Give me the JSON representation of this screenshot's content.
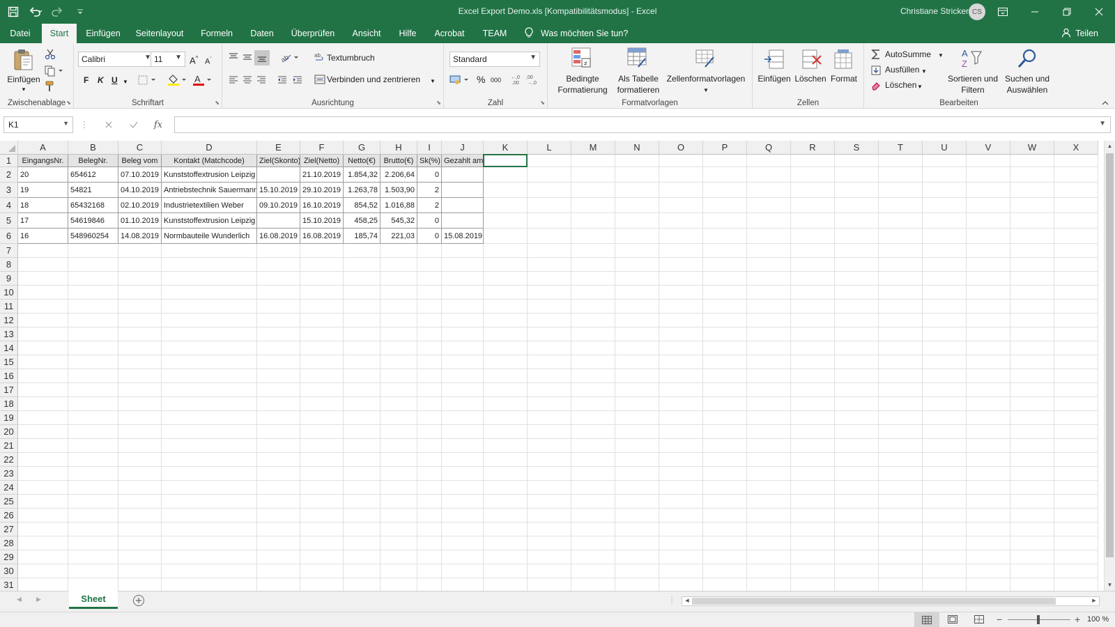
{
  "window": {
    "title": "Excel Export Demo.xls  [Kompatibilitätsmodus]  -  Excel",
    "user": "Christiane Stricker",
    "initials": "CS"
  },
  "menu": {
    "tabs": [
      "Datei",
      "Start",
      "Einfügen",
      "Seitenlayout",
      "Formeln",
      "Daten",
      "Überprüfen",
      "Ansicht",
      "Hilfe",
      "Acrobat",
      "TEAM"
    ],
    "active": "Start",
    "tell_me": "Was möchten Sie tun?",
    "share": "Teilen"
  },
  "ribbon": {
    "clipboard": {
      "label": "Zwischenablage",
      "paste": "Einfügen"
    },
    "font": {
      "label": "Schriftart",
      "name": "Calibri",
      "size": "11",
      "bold": "F",
      "italic": "K",
      "underline": "U"
    },
    "alignment": {
      "label": "Ausrichtung",
      "wrap": "Textumbruch",
      "merge": "Verbinden und zentrieren"
    },
    "number": {
      "label": "Zahl",
      "format": "Standard",
      "percent": "%",
      "thousands": "000"
    },
    "styles": {
      "label": "Formatvorlagen",
      "conditional_1": "Bedingte",
      "conditional_2": "Formatierung",
      "table_1": "Als Tabelle",
      "table_2": "formatieren",
      "cellstyles": "Zellenformatvorlagen"
    },
    "cells": {
      "label": "Zellen",
      "insert": "Einfügen",
      "delete": "Löschen",
      "format": "Format"
    },
    "editing": {
      "label": "Bearbeiten",
      "autosum": "AutoSumme",
      "fill": "Ausfüllen",
      "clear": "Löschen",
      "sort_1": "Sortieren und",
      "sort_2": "Filtern",
      "find_1": "Suchen und",
      "find_2": "Auswählen"
    }
  },
  "formula_bar": {
    "name_box": "K1",
    "fx": "fx",
    "content": ""
  },
  "columns": [
    "A",
    "B",
    "C",
    "D",
    "E",
    "F",
    "G",
    "H",
    "I",
    "J",
    "K",
    "L",
    "M",
    "N",
    "O",
    "P",
    "Q",
    "R",
    "S",
    "T",
    "U",
    "V",
    "W",
    "X"
  ],
  "rows": [
    "1",
    "2",
    "3",
    "4",
    "5",
    "6",
    "7",
    "8",
    "9",
    "10",
    "11",
    "12",
    "13",
    "14",
    "15",
    "16",
    "17",
    "18",
    "19",
    "20",
    "21",
    "22",
    "23",
    "24",
    "25",
    "26",
    "27",
    "28",
    "29",
    "30",
    "31"
  ],
  "table": {
    "headers": [
      "EingangsNr.",
      "BelegNr.",
      "Beleg vom",
      "Kontakt (Matchcode)",
      "Ziel(Skonto)",
      "Ziel(Netto)",
      "Netto(€)",
      "Brutto(€)",
      "Sk(%)",
      "Gezahlt am"
    ],
    "rows": [
      [
        "20",
        "654612",
        "07.10.2019",
        "Kunststoffextrusion Leipzig",
        "",
        "21.10.2019",
        "1.854,32",
        "2.206,64",
        "0",
        ""
      ],
      [
        "19",
        "54821",
        "04.10.2019",
        "Antriebstechnik Sauermann",
        "15.10.2019",
        "29.10.2019",
        "1.263,78",
        "1.503,90",
        "2",
        ""
      ],
      [
        "18",
        "65432168",
        "02.10.2019",
        "Industrietextilien Weber",
        "09.10.2019",
        "16.10.2019",
        "854,52",
        "1.016,88",
        "2",
        ""
      ],
      [
        "17",
        "54619846",
        "01.10.2019",
        "Kunststoffextrusion Leipzig",
        "",
        "15.10.2019",
        "458,25",
        "545,32",
        "0",
        ""
      ],
      [
        "16",
        "548960254",
        "14.08.2019",
        "Normbauteile Wunderlich",
        "16.08.2019",
        "16.08.2019",
        "185,74",
        "221,03",
        "0",
        "15.08.2019"
      ]
    ]
  },
  "sheets": {
    "active": "Sheet"
  },
  "status": {
    "zoom": "100 %"
  },
  "colors": {
    "brand": "#217346",
    "ribbon": "#f3f3f3",
    "header": "#f0f0f0"
  }
}
